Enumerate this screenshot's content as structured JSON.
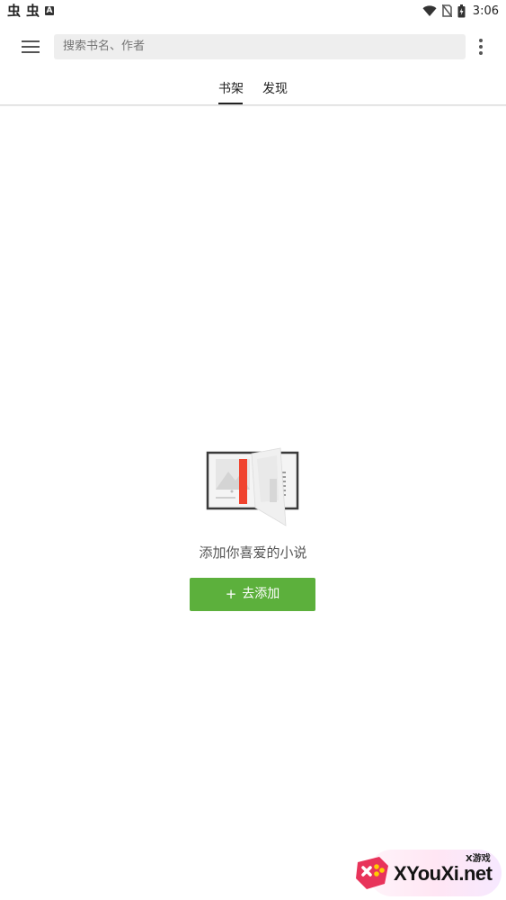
{
  "status_bar": {
    "left_glyph_1": "虫",
    "left_glyph_2": "虫",
    "left_badge": "A",
    "time": "3:06"
  },
  "top_bar": {
    "search_placeholder": "搜索书名、作者",
    "menu_icon": "hamburger-menu-icon",
    "more_icon": "vertical-dots-icon"
  },
  "tabs": [
    {
      "label": "书架",
      "selected": true
    },
    {
      "label": "发现",
      "selected": false
    }
  ],
  "empty_state": {
    "illustration": "open-book-icon",
    "message": "添加你喜爱的小说",
    "button_label": "去添加",
    "button_icon": "plus-icon",
    "button_color": "#5cb03c"
  },
  "watermark": {
    "small_text": "X游戏",
    "brand_text": "XYouXi.net"
  }
}
